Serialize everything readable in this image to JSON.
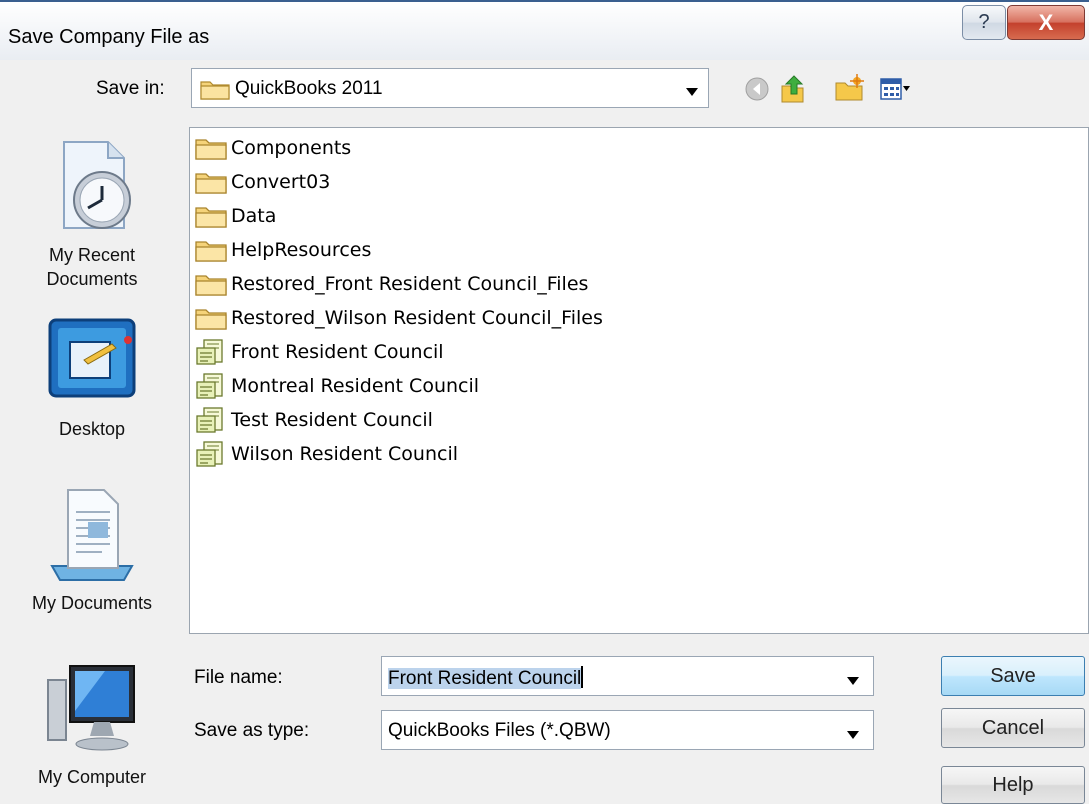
{
  "window": {
    "title": "Save Company File as",
    "help_label": "?",
    "close_label": "X"
  },
  "save_in": {
    "label": "Save in:",
    "value": "QuickBooks 2011"
  },
  "toolbar": {
    "back_icon": "back-arrow-icon",
    "up_icon": "up-folder-icon",
    "new_folder_icon": "new-folder-icon",
    "views_icon": "views-menu-icon"
  },
  "places": [
    {
      "label": "My Recent Documents",
      "icon": "recent-documents-icon"
    },
    {
      "label": "Desktop",
      "icon": "desktop-icon"
    },
    {
      "label": "My Documents",
      "icon": "my-documents-icon"
    },
    {
      "label": "My Computer",
      "icon": "my-computer-icon"
    }
  ],
  "files": [
    {
      "name": "Components",
      "type": "folder"
    },
    {
      "name": "Convert03",
      "type": "folder"
    },
    {
      "name": "Data",
      "type": "folder"
    },
    {
      "name": "HelpResources",
      "type": "folder"
    },
    {
      "name": "Restored_Front Resident Council_Files",
      "type": "folder"
    },
    {
      "name": "Restored_Wilson Resident Council_Files",
      "type": "folder"
    },
    {
      "name": "Front Resident Council",
      "type": "qbw"
    },
    {
      "name": "Montreal Resident Council",
      "type": "qbw"
    },
    {
      "name": "Test Resident Council",
      "type": "qbw"
    },
    {
      "name": "Wilson Resident Council",
      "type": "qbw"
    }
  ],
  "file_name": {
    "label": "File name:",
    "value": "Front Resident Council"
  },
  "save_as_type": {
    "label": "Save as type:",
    "value": "QuickBooks Files (*.QBW)"
  },
  "buttons": {
    "save": "Save",
    "cancel": "Cancel",
    "help": "Help"
  },
  "colors": {
    "selection": "#bcd3ec",
    "default_button": "#bee6fd",
    "close_button": "#c3402c",
    "folder": "#f5d37a"
  }
}
